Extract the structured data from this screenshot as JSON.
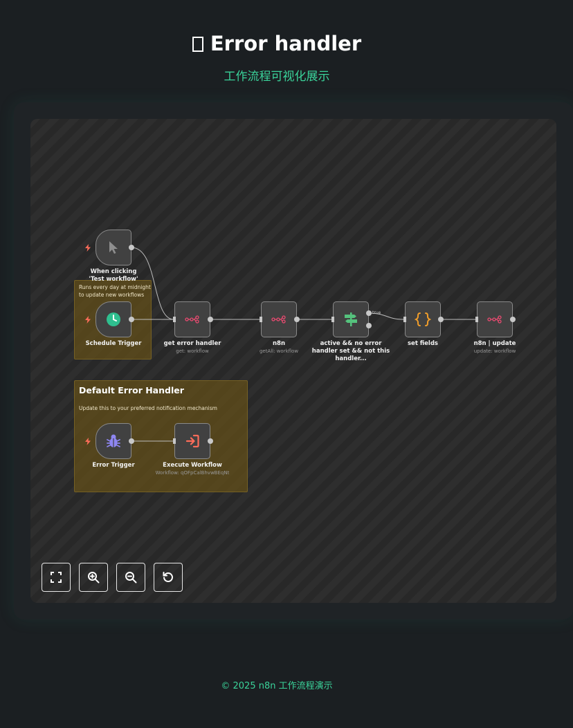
{
  "page": {
    "title": "Error handler",
    "subtitle": "工作流程可视化展示",
    "footer": "© 2025 n8n 工作流程演示"
  },
  "stickies": {
    "schedule_note": "Runs every day at midnight to update new workflows",
    "default_heading": "Default Error Handler",
    "default_note": "Update this to your preferred notification mechanism"
  },
  "nodes": {
    "manual": {
      "label": "When clicking 'Test workflow'",
      "icon": "cursor-icon"
    },
    "schedule": {
      "label": "Schedule Trigger",
      "icon": "clock-icon"
    },
    "get_error_handler": {
      "label": "get error handler",
      "sub": "get: workflow",
      "icon": "n8n-icon"
    },
    "n8n": {
      "label": "n8n",
      "sub": "getAll: workflow",
      "icon": "n8n-icon"
    },
    "filter": {
      "label": "active && no error handler set && not this handler...",
      "icon": "signpost-icon",
      "branch": "true"
    },
    "set_fields": {
      "label": "set fields",
      "icon": "braces-icon"
    },
    "n8n_update": {
      "label": "n8n | update",
      "sub": "update: workflow",
      "icon": "n8n-icon"
    },
    "error_trigger": {
      "label": "Error Trigger",
      "icon": "bug-icon"
    },
    "execute_workflow": {
      "label": "Execute Workflow",
      "sub": "Workflow: qOFpCalBhvwBEqNt",
      "icon": "enter-icon"
    }
  },
  "controls": [
    {
      "name": "fit-view-button",
      "icon": "fullscreen-icon"
    },
    {
      "name": "zoom-in-button",
      "icon": "zoom-in-icon"
    },
    {
      "name": "zoom-out-button",
      "icon": "zoom-out-icon"
    },
    {
      "name": "reset-zoom-button",
      "icon": "undo-icon"
    }
  ],
  "colors": {
    "accent": "#3ad39a",
    "sticky": "#604d19",
    "trigger_bolt": "#ff6d5a",
    "n8n_pink": "#ea4b71",
    "filter_green": "#55c27d",
    "set_orange": "#f29e2a",
    "error_purple": "#8e86f2",
    "execute_red": "#ff6d5a"
  }
}
